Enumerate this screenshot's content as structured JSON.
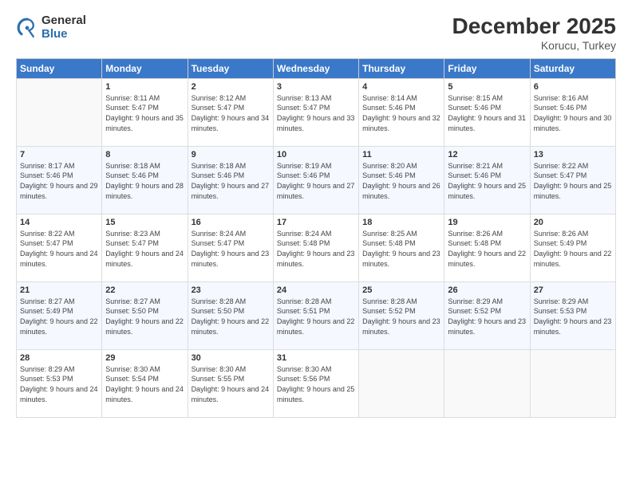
{
  "logo": {
    "general": "General",
    "blue": "Blue"
  },
  "title": "December 2025",
  "subtitle": "Korucu, Turkey",
  "weekdays": [
    "Sunday",
    "Monday",
    "Tuesday",
    "Wednesday",
    "Thursday",
    "Friday",
    "Saturday"
  ],
  "weeks": [
    [
      {
        "day": "",
        "sunrise": "",
        "sunset": "",
        "daylight": "",
        "empty": true
      },
      {
        "day": "1",
        "sunrise": "Sunrise: 8:11 AM",
        "sunset": "Sunset: 5:47 PM",
        "daylight": "Daylight: 9 hours and 35 minutes.",
        "empty": false
      },
      {
        "day": "2",
        "sunrise": "Sunrise: 8:12 AM",
        "sunset": "Sunset: 5:47 PM",
        "daylight": "Daylight: 9 hours and 34 minutes.",
        "empty": false
      },
      {
        "day": "3",
        "sunrise": "Sunrise: 8:13 AM",
        "sunset": "Sunset: 5:47 PM",
        "daylight": "Daylight: 9 hours and 33 minutes.",
        "empty": false
      },
      {
        "day": "4",
        "sunrise": "Sunrise: 8:14 AM",
        "sunset": "Sunset: 5:46 PM",
        "daylight": "Daylight: 9 hours and 32 minutes.",
        "empty": false
      },
      {
        "day": "5",
        "sunrise": "Sunrise: 8:15 AM",
        "sunset": "Sunset: 5:46 PM",
        "daylight": "Daylight: 9 hours and 31 minutes.",
        "empty": false
      },
      {
        "day": "6",
        "sunrise": "Sunrise: 8:16 AM",
        "sunset": "Sunset: 5:46 PM",
        "daylight": "Daylight: 9 hours and 30 minutes.",
        "empty": false
      }
    ],
    [
      {
        "day": "7",
        "sunrise": "Sunrise: 8:17 AM",
        "sunset": "Sunset: 5:46 PM",
        "daylight": "Daylight: 9 hours and 29 minutes.",
        "empty": false
      },
      {
        "day": "8",
        "sunrise": "Sunrise: 8:18 AM",
        "sunset": "Sunset: 5:46 PM",
        "daylight": "Daylight: 9 hours and 28 minutes.",
        "empty": false
      },
      {
        "day": "9",
        "sunrise": "Sunrise: 8:18 AM",
        "sunset": "Sunset: 5:46 PM",
        "daylight": "Daylight: 9 hours and 27 minutes.",
        "empty": false
      },
      {
        "day": "10",
        "sunrise": "Sunrise: 8:19 AM",
        "sunset": "Sunset: 5:46 PM",
        "daylight": "Daylight: 9 hours and 27 minutes.",
        "empty": false
      },
      {
        "day": "11",
        "sunrise": "Sunrise: 8:20 AM",
        "sunset": "Sunset: 5:46 PM",
        "daylight": "Daylight: 9 hours and 26 minutes.",
        "empty": false
      },
      {
        "day": "12",
        "sunrise": "Sunrise: 8:21 AM",
        "sunset": "Sunset: 5:46 PM",
        "daylight": "Daylight: 9 hours and 25 minutes.",
        "empty": false
      },
      {
        "day": "13",
        "sunrise": "Sunrise: 8:22 AM",
        "sunset": "Sunset: 5:47 PM",
        "daylight": "Daylight: 9 hours and 25 minutes.",
        "empty": false
      }
    ],
    [
      {
        "day": "14",
        "sunrise": "Sunrise: 8:22 AM",
        "sunset": "Sunset: 5:47 PM",
        "daylight": "Daylight: 9 hours and 24 minutes.",
        "empty": false
      },
      {
        "day": "15",
        "sunrise": "Sunrise: 8:23 AM",
        "sunset": "Sunset: 5:47 PM",
        "daylight": "Daylight: 9 hours and 24 minutes.",
        "empty": false
      },
      {
        "day": "16",
        "sunrise": "Sunrise: 8:24 AM",
        "sunset": "Sunset: 5:47 PM",
        "daylight": "Daylight: 9 hours and 23 minutes.",
        "empty": false
      },
      {
        "day": "17",
        "sunrise": "Sunrise: 8:24 AM",
        "sunset": "Sunset: 5:48 PM",
        "daylight": "Daylight: 9 hours and 23 minutes.",
        "empty": false
      },
      {
        "day": "18",
        "sunrise": "Sunrise: 8:25 AM",
        "sunset": "Sunset: 5:48 PM",
        "daylight": "Daylight: 9 hours and 23 minutes.",
        "empty": false
      },
      {
        "day": "19",
        "sunrise": "Sunrise: 8:26 AM",
        "sunset": "Sunset: 5:48 PM",
        "daylight": "Daylight: 9 hours and 22 minutes.",
        "empty": false
      },
      {
        "day": "20",
        "sunrise": "Sunrise: 8:26 AM",
        "sunset": "Sunset: 5:49 PM",
        "daylight": "Daylight: 9 hours and 22 minutes.",
        "empty": false
      }
    ],
    [
      {
        "day": "21",
        "sunrise": "Sunrise: 8:27 AM",
        "sunset": "Sunset: 5:49 PM",
        "daylight": "Daylight: 9 hours and 22 minutes.",
        "empty": false
      },
      {
        "day": "22",
        "sunrise": "Sunrise: 8:27 AM",
        "sunset": "Sunset: 5:50 PM",
        "daylight": "Daylight: 9 hours and 22 minutes.",
        "empty": false
      },
      {
        "day": "23",
        "sunrise": "Sunrise: 8:28 AM",
        "sunset": "Sunset: 5:50 PM",
        "daylight": "Daylight: 9 hours and 22 minutes.",
        "empty": false
      },
      {
        "day": "24",
        "sunrise": "Sunrise: 8:28 AM",
        "sunset": "Sunset: 5:51 PM",
        "daylight": "Daylight: 9 hours and 22 minutes.",
        "empty": false
      },
      {
        "day": "25",
        "sunrise": "Sunrise: 8:28 AM",
        "sunset": "Sunset: 5:52 PM",
        "daylight": "Daylight: 9 hours and 23 minutes.",
        "empty": false
      },
      {
        "day": "26",
        "sunrise": "Sunrise: 8:29 AM",
        "sunset": "Sunset: 5:52 PM",
        "daylight": "Daylight: 9 hours and 23 minutes.",
        "empty": false
      },
      {
        "day": "27",
        "sunrise": "Sunrise: 8:29 AM",
        "sunset": "Sunset: 5:53 PM",
        "daylight": "Daylight: 9 hours and 23 minutes.",
        "empty": false
      }
    ],
    [
      {
        "day": "28",
        "sunrise": "Sunrise: 8:29 AM",
        "sunset": "Sunset: 5:53 PM",
        "daylight": "Daylight: 9 hours and 24 minutes.",
        "empty": false
      },
      {
        "day": "29",
        "sunrise": "Sunrise: 8:30 AM",
        "sunset": "Sunset: 5:54 PM",
        "daylight": "Daylight: 9 hours and 24 minutes.",
        "empty": false
      },
      {
        "day": "30",
        "sunrise": "Sunrise: 8:30 AM",
        "sunset": "Sunset: 5:55 PM",
        "daylight": "Daylight: 9 hours and 24 minutes.",
        "empty": false
      },
      {
        "day": "31",
        "sunrise": "Sunrise: 8:30 AM",
        "sunset": "Sunset: 5:56 PM",
        "daylight": "Daylight: 9 hours and 25 minutes.",
        "empty": false
      },
      {
        "day": "",
        "sunrise": "",
        "sunset": "",
        "daylight": "",
        "empty": true
      },
      {
        "day": "",
        "sunrise": "",
        "sunset": "",
        "daylight": "",
        "empty": true
      },
      {
        "day": "",
        "sunrise": "",
        "sunset": "",
        "daylight": "",
        "empty": true
      }
    ]
  ]
}
